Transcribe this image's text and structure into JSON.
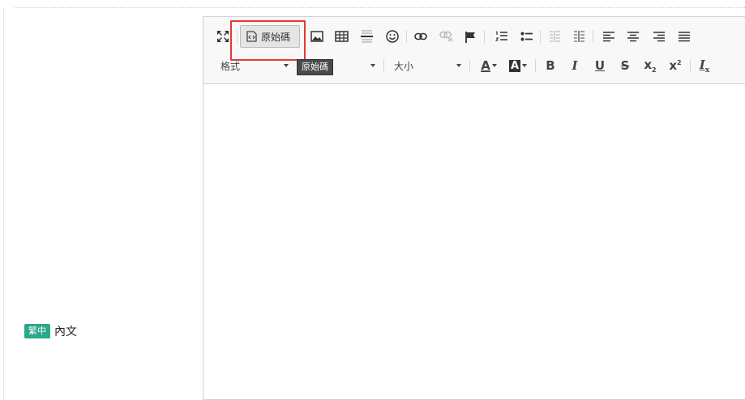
{
  "field": {
    "language_badge": "繁中",
    "label": "內文"
  },
  "toolbar": {
    "source_label": "原始碼",
    "tooltip": "原始碼",
    "format_combo": "格式",
    "size_combo": "大小",
    "icons": [
      "maximize-icon",
      "source-icon",
      "image-icon",
      "table-icon",
      "horizontal-rule-icon",
      "smiley-icon",
      "link-icon",
      "unlink-icon",
      "anchor-icon",
      "numbered-list-icon",
      "bulleted-list-icon",
      "outdent-icon",
      "indent-icon",
      "align-left-icon",
      "align-center-icon",
      "align-right-icon",
      "justify-icon",
      "text-color-icon",
      "background-color-icon",
      "bold-icon",
      "italic-icon",
      "underline-icon",
      "strikethrough-icon",
      "subscript-icon",
      "superscript-icon",
      "remove-format-icon"
    ],
    "text_color_glyph": "A",
    "bg_color_glyph": "A",
    "bold_glyph": "B",
    "italic_glyph": "I",
    "underline_glyph": "U",
    "strike_glyph": "S",
    "sub_glyph": "x",
    "sub_script": "2",
    "sup_glyph": "x",
    "sup_script": "2",
    "remove_format_glyph": "I",
    "remove_format_script": "x"
  },
  "colors": {
    "badge": "#2aa889",
    "highlight": "#e53935"
  }
}
